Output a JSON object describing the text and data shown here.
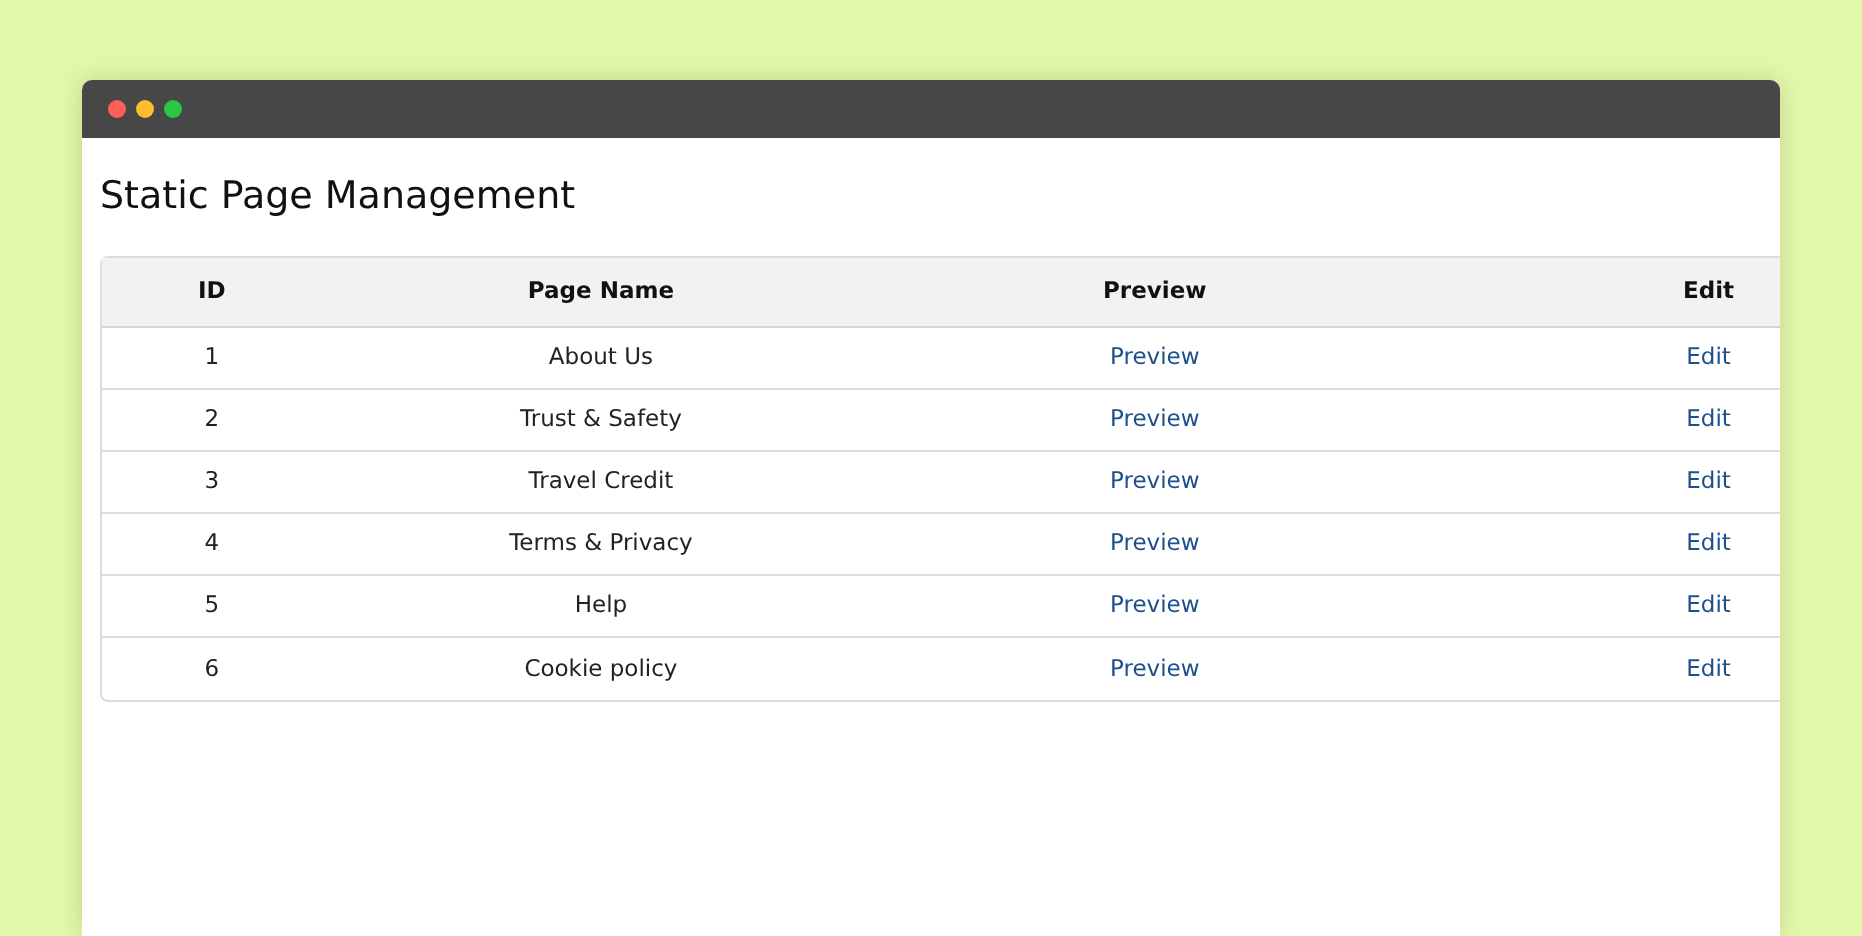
{
  "page": {
    "title": "Static Page Management"
  },
  "table": {
    "columns": [
      "ID",
      "Page Name",
      "Preview",
      "Edit"
    ],
    "rows": [
      {
        "id": "1",
        "page_name": "About Us",
        "preview": "Preview",
        "edit": "Edit"
      },
      {
        "id": "2",
        "page_name": "Trust & Safety",
        "preview": "Preview",
        "edit": "Edit"
      },
      {
        "id": "3",
        "page_name": "Travel Credit",
        "preview": "Preview",
        "edit": "Edit"
      },
      {
        "id": "4",
        "page_name": "Terms & Privacy",
        "preview": "Preview",
        "edit": "Edit"
      },
      {
        "id": "5",
        "page_name": "Help",
        "preview": "Preview",
        "edit": "Edit"
      },
      {
        "id": "6",
        "page_name": "Cookie policy",
        "preview": "Preview",
        "edit": "Edit"
      }
    ]
  }
}
